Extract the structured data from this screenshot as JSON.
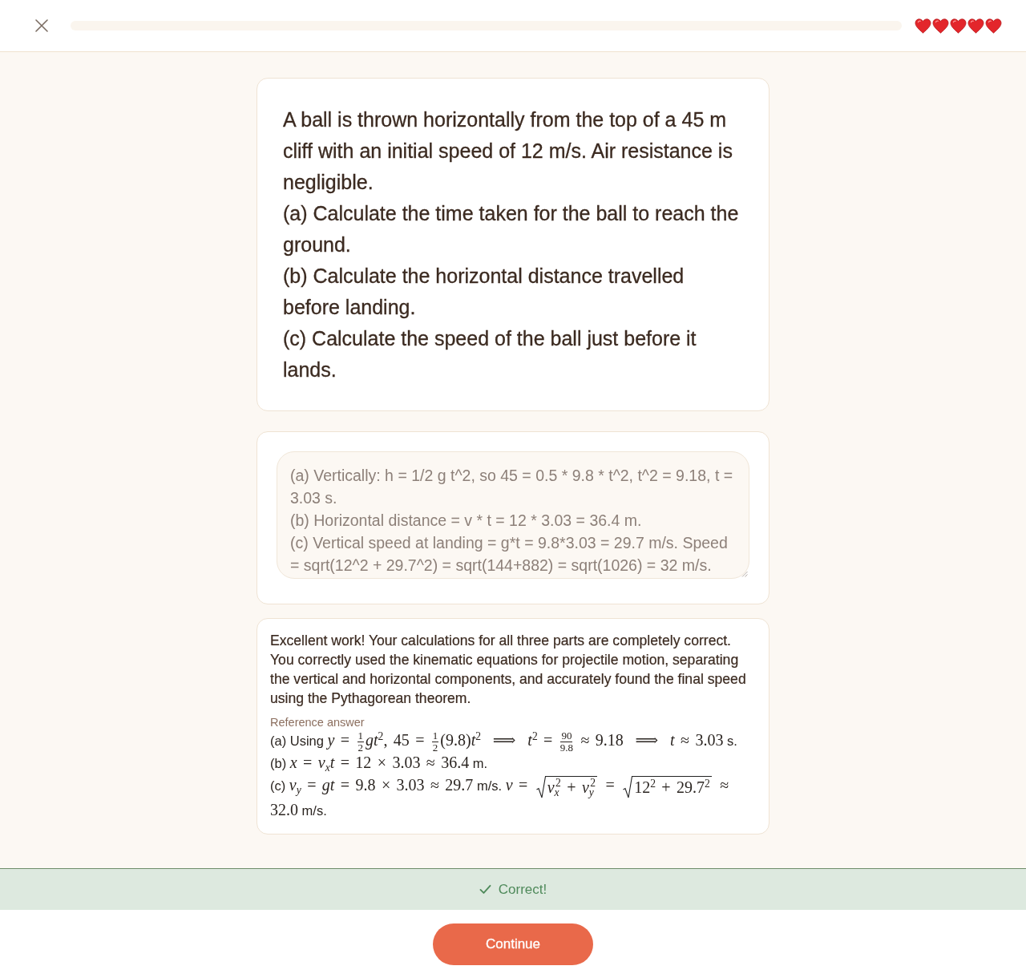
{
  "header": {
    "hearts": [
      {
        "filled": true
      },
      {
        "filled": true
      },
      {
        "filled": true
      },
      {
        "filled": true
      },
      {
        "filled": true
      }
    ]
  },
  "question": {
    "text": "A ball is thrown horizontally from the top of a 45 m cliff with an initial speed of 12 m/s. Air resistance is negligible.\n(a) Calculate the time taken for the ball to reach the ground.\n(b) Calculate the horizontal distance travelled before landing.\n(c) Calculate the speed of the ball just before it lands."
  },
  "answer": {
    "value": "(a) Vertically: h = 1/2 g t^2, so 45 = 0.5 * 9.8 * t^2, t^2 = 9.18, t = 3.03 s.\n(b) Horizontal distance = v * t = 12 * 3.03 = 36.4 m.\n(c) Vertical speed at landing = g*t = 9.8*3.03 = 29.7 m/s. Speed = sqrt(12^2 + 29.7^2) = sqrt(144+882) = sqrt(1026) = 32 m/s."
  },
  "feedback": {
    "message": "Excellent work! Your calculations for all three parts are completely correct. You correctly used the kinematic equations for projectile motion, separating the vertical and horizontal components, and accurately found the final speed using the Pythagorean theorem.",
    "reference_label": "Reference answer",
    "reference_lines": [
      [
        {
          "kind": "text",
          "text": "(a) Using "
        },
        {
          "kind": "math",
          "text": "*y* = "
        },
        {
          "kind": "frac",
          "num": "1",
          "den": "2"
        },
        {
          "kind": "math",
          "text": "*gt*$^{2}$, 45 = "
        },
        {
          "kind": "frac",
          "num": "1",
          "den": "2"
        },
        {
          "kind": "math",
          "text": "(9.8)*t*$^{2}$  ⟹  *t*$^{2}$ = "
        },
        {
          "kind": "frac",
          "num": "90",
          "den": "9.8"
        },
        {
          "kind": "math",
          "text": " ≈ 9.18  ⟹  *t* ≈ 3.03"
        },
        {
          "kind": "text",
          "text": " s."
        }
      ],
      [
        {
          "kind": "text",
          "text": "(b) "
        },
        {
          "kind": "math",
          "text": "*x* = *v*$_{x}$*t* = 12 × 3.03 ≈ 36.4"
        },
        {
          "kind": "text",
          "text": " m."
        }
      ],
      [
        {
          "kind": "text",
          "text": "(c) "
        },
        {
          "kind": "math",
          "text": "*v*$_{y}$ = *gt* = 9.8 × 3.03 ≈ 29.7"
        },
        {
          "kind": "text",
          "text": " m/s. "
        },
        {
          "kind": "math",
          "text": "*v* = "
        },
        {
          "kind": "sqrt",
          "text": "*v*$_{x}$$^{2}$ + *v*$_{y}$$^{2}$"
        },
        {
          "kind": "math",
          "text": " = "
        },
        {
          "kind": "sqrt",
          "text": "12$^{2}$ + 29.7$^{2}$"
        },
        {
          "kind": "math",
          "text": " ≈ "
        },
        {
          "kind": "math",
          "text": "32.0"
        },
        {
          "kind": "text",
          "text": " m/s."
        }
      ]
    ]
  },
  "result": {
    "correct": true,
    "label": "Correct!"
  },
  "continue_button": {
    "label": "Continue"
  }
}
